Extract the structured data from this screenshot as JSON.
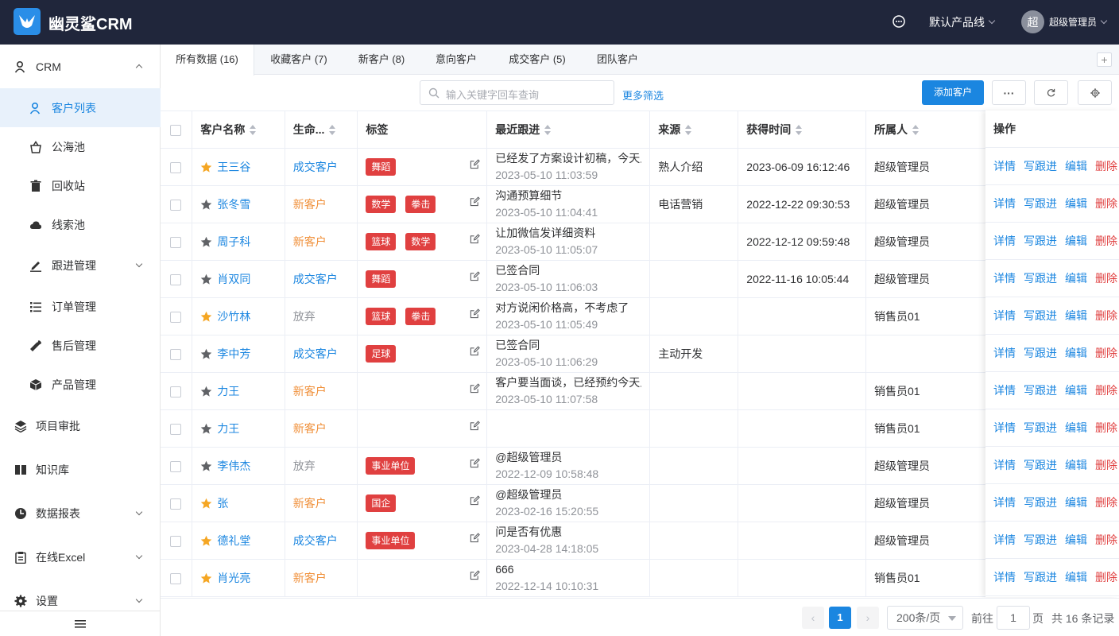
{
  "app": {
    "brand": "幽灵鲨CRM",
    "product_line": "默认产品线",
    "avatar_char": "超",
    "user": "超级管理员"
  },
  "sidebar": {
    "crm": "CRM",
    "items": [
      {
        "label": "客户列表",
        "icon": "user-icon"
      },
      {
        "label": "公海池",
        "icon": "basket-icon"
      },
      {
        "label": "回收站",
        "icon": "trash-icon"
      },
      {
        "label": "线索池",
        "icon": "cloud-icon"
      },
      {
        "label": "跟进管理",
        "icon": "pen-icon"
      },
      {
        "label": "订单管理",
        "icon": "list-icon"
      },
      {
        "label": "售后管理",
        "icon": "wrench-icon"
      },
      {
        "label": "产品管理",
        "icon": "box-icon"
      }
    ],
    "groups": [
      {
        "label": "项目审批",
        "icon": "layers-icon"
      },
      {
        "label": "知识库",
        "icon": "book-icon"
      },
      {
        "label": "数据报表",
        "icon": "chart-icon"
      },
      {
        "label": "在线Excel",
        "icon": "clipboard-icon"
      },
      {
        "label": "设置",
        "icon": "gear-icon"
      }
    ]
  },
  "tabs": [
    {
      "label": "所有数据 (16)"
    },
    {
      "label": "收藏客户 (7)"
    },
    {
      "label": "新客户 (8)"
    },
    {
      "label": "意向客户"
    },
    {
      "label": "成交客户 (5)"
    },
    {
      "label": "团队客户"
    }
  ],
  "toolbar": {
    "search_placeholder": "输入关键字回车查询",
    "more_filter": "更多筛选",
    "add_label": "添加客户",
    "more": "···"
  },
  "table": {
    "headers": {
      "name": "客户名称",
      "lifecycle": "生命...",
      "tags": "标签",
      "followup": "最近跟进",
      "source": "来源",
      "obtained": "获得时间",
      "owner": "所属人",
      "ops": "操作"
    },
    "rows": [
      {
        "starred": true,
        "name": "王三谷",
        "lifecycle": "成交客户",
        "lc": "deal",
        "tags": [
          "舞蹈"
        ],
        "fu_text": "已经发了方案设计初稿，今天上",
        "fu_time": "2023-05-10 11:03:59",
        "source": "熟人介绍",
        "obtained": "2023-06-09 16:12:46",
        "owner": "超级管理员"
      },
      {
        "starred": false,
        "name": "张冬雪",
        "lifecycle": "新客户",
        "lc": "new",
        "tags": [
          "数学",
          "拳击"
        ],
        "fu_text": "沟通预算细节",
        "fu_time": "2023-05-10 11:04:41",
        "source": "电话营销",
        "obtained": "2022-12-22 09:30:53",
        "owner": "超级管理员"
      },
      {
        "starred": false,
        "name": "周子科",
        "lifecycle": "新客户",
        "lc": "new",
        "tags": [
          "篮球",
          "数学"
        ],
        "fu_text": "让加微信发详细资料",
        "fu_time": "2023-05-10 11:05:07",
        "source": "",
        "obtained": "2022-12-12 09:59:48",
        "owner": "超级管理员"
      },
      {
        "starred": false,
        "name": "肖双同",
        "lifecycle": "成交客户",
        "lc": "deal",
        "tags": [
          "舞蹈"
        ],
        "fu_text": "已签合同",
        "fu_time": "2023-05-10 11:06:03",
        "source": "",
        "obtained": "2022-11-16 10:05:44",
        "owner": "超级管理员"
      },
      {
        "starred": true,
        "name": "沙竹林",
        "lifecycle": "放弃",
        "lc": "drop",
        "tags": [
          "篮球",
          "拳击"
        ],
        "fu_text": "对方说闲价格高，不考虑了",
        "fu_time": "2023-05-10 11:05:49",
        "source": "",
        "obtained": "",
        "owner": "销售员01"
      },
      {
        "starred": false,
        "name": "李中芳",
        "lifecycle": "成交客户",
        "lc": "deal",
        "tags": [
          "足球"
        ],
        "fu_text": "已签合同",
        "fu_time": "2023-05-10 11:06:29",
        "source": "主动开发",
        "obtained": "",
        "owner": ""
      },
      {
        "starred": false,
        "name": "力王",
        "lifecycle": "新客户",
        "lc": "new",
        "tags": [],
        "fu_text": "客户要当面谈，已经预约今天上",
        "fu_time": "2023-05-10 11:07:58",
        "source": "",
        "obtained": "",
        "owner": "销售员01"
      },
      {
        "starred": false,
        "name": "力王",
        "lifecycle": "新客户",
        "lc": "new",
        "tags": [],
        "fu_text": "",
        "fu_time": "",
        "source": "",
        "obtained": "",
        "owner": "销售员01"
      },
      {
        "starred": false,
        "name": "李伟杰",
        "lifecycle": "放弃",
        "lc": "drop",
        "tags": [
          "事业单位"
        ],
        "fu_text": "@超级管理员",
        "fu_time": "2022-12-09 10:58:48",
        "source": "",
        "obtained": "",
        "owner": "超级管理员"
      },
      {
        "starred": true,
        "name": "张",
        "lifecycle": "新客户",
        "lc": "new",
        "tags": [
          "国企"
        ],
        "fu_text": "@超级管理员",
        "fu_time": "2023-02-16 15:20:55",
        "source": "",
        "obtained": "",
        "owner": "超级管理员"
      },
      {
        "starred": true,
        "name": "德礼堂",
        "lifecycle": "成交客户",
        "lc": "deal",
        "tags": [
          "事业单位"
        ],
        "fu_text": "问是否有优惠",
        "fu_time": "2023-04-28 14:18:05",
        "source": "",
        "obtained": "",
        "owner": "超级管理员"
      },
      {
        "starred": true,
        "name": "肖光亮",
        "lifecycle": "新客户",
        "lc": "new",
        "tags": [],
        "fu_text": "666",
        "fu_time": "2022-12-14 10:10:31",
        "source": "",
        "obtained": "",
        "owner": "销售员01"
      }
    ],
    "actions": [
      "详情",
      "写跟进",
      "编辑",
      "删除"
    ]
  },
  "pager": {
    "current": "1",
    "size": "200条/页",
    "goto_prefix": "前往",
    "goto_value": "1",
    "goto_suffix": "页",
    "total": "共 16 条记录"
  },
  "colors": {
    "accent": "#1b86e0",
    "deal": "#1b86e0",
    "new": "#f0903a",
    "drop": "#909399",
    "tag": "#e04040",
    "star_on": "#f5a623",
    "star_off": "#606266"
  }
}
